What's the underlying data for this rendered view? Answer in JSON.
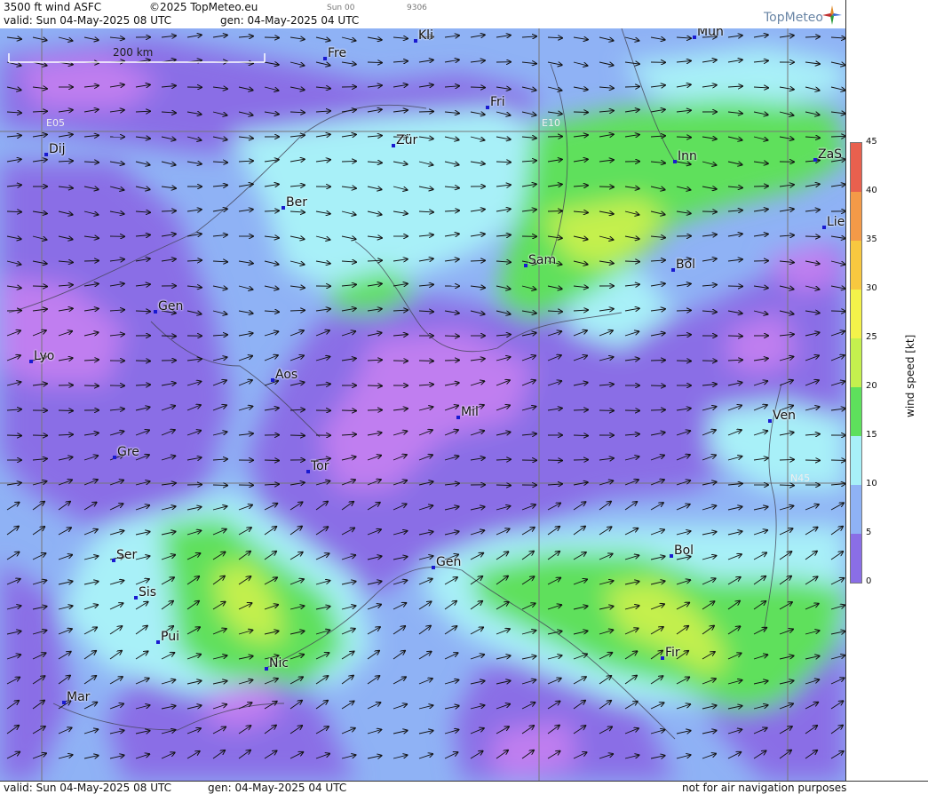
{
  "header": {
    "product": "3500 ft wind ASFC",
    "copyright": "©2025 TopMeteo.eu",
    "run": "Sun 00",
    "code": "9306",
    "valid": "valid:  Sun  04-May-2025  08 UTC",
    "gen": "gen: 04-May-2025 04 UTC",
    "logo": "TopMeteo"
  },
  "footer": {
    "valid": "valid:  Sun  04-May-2025  08 UTC",
    "gen": "gen: 04-May-2025 04 UTC",
    "notice": "not for air navigation purposes"
  },
  "scale_bar": "200 km",
  "grid_labels": {
    "lon1": "E05",
    "lon2": "E10",
    "lat1": "N45"
  },
  "cities": [
    "Mun",
    "Kli",
    "Fre",
    "Fri",
    "Dij",
    "Zür",
    "Inn",
    "ZaS",
    "Ber",
    "Lie",
    "Sam",
    "Bol",
    "Gen",
    "Lyo",
    "Aos",
    "Mil",
    "Ven",
    "Gre",
    "Tor",
    "Ser",
    "Bol",
    "Gen",
    "Sis",
    "Pui",
    "Fir",
    "Nic",
    "Mar"
  ],
  "legend": {
    "title": "wind speed [kt]",
    "ticks": [
      "45",
      "40",
      "35",
      "30",
      "25",
      "20",
      "15",
      "10",
      "5",
      "0"
    ],
    "colors": {
      "0": "#c07ef0",
      "5": "#8a6ee6",
      "10": "#8fb2f5",
      "15": "#a8f0f8",
      "20": "#5ee05c",
      "25": "#c4f04e",
      "30": "#f4f24a",
      "35": "#f8c840",
      "40": "#f49a48",
      "45": "#e8604e"
    }
  }
}
